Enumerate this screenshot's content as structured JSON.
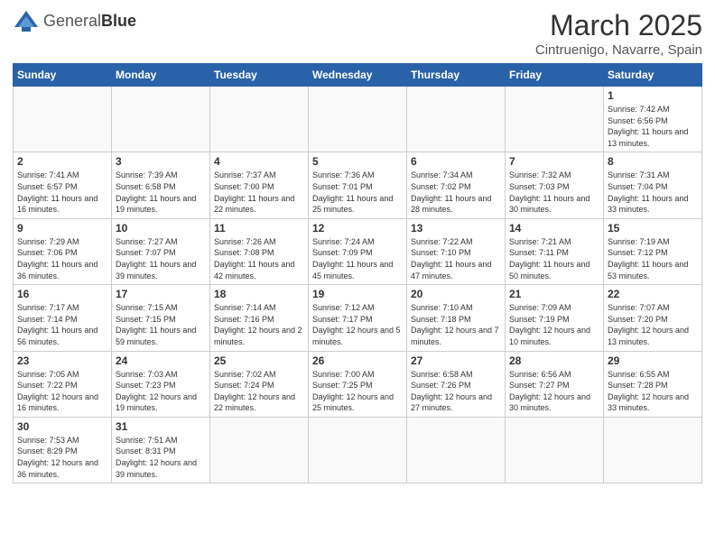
{
  "logo": {
    "text_normal": "General",
    "text_bold": "Blue"
  },
  "title": {
    "month_year": "March 2025",
    "location": "Cintruenigo, Navarre, Spain"
  },
  "days_of_week": [
    "Sunday",
    "Monday",
    "Tuesday",
    "Wednesday",
    "Thursday",
    "Friday",
    "Saturday"
  ],
  "weeks": [
    {
      "days": [
        {
          "num": "",
          "info": ""
        },
        {
          "num": "",
          "info": ""
        },
        {
          "num": "",
          "info": ""
        },
        {
          "num": "",
          "info": ""
        },
        {
          "num": "",
          "info": ""
        },
        {
          "num": "",
          "info": ""
        },
        {
          "num": "1",
          "info": "Sunrise: 7:42 AM\nSunset: 6:56 PM\nDaylight: 11 hours and 13 minutes."
        }
      ]
    },
    {
      "days": [
        {
          "num": "2",
          "info": "Sunrise: 7:41 AM\nSunset: 6:57 PM\nDaylight: 11 hours and 16 minutes."
        },
        {
          "num": "3",
          "info": "Sunrise: 7:39 AM\nSunset: 6:58 PM\nDaylight: 11 hours and 19 minutes."
        },
        {
          "num": "4",
          "info": "Sunrise: 7:37 AM\nSunset: 7:00 PM\nDaylight: 11 hours and 22 minutes."
        },
        {
          "num": "5",
          "info": "Sunrise: 7:36 AM\nSunset: 7:01 PM\nDaylight: 11 hours and 25 minutes."
        },
        {
          "num": "6",
          "info": "Sunrise: 7:34 AM\nSunset: 7:02 PM\nDaylight: 11 hours and 28 minutes."
        },
        {
          "num": "7",
          "info": "Sunrise: 7:32 AM\nSunset: 7:03 PM\nDaylight: 11 hours and 30 minutes."
        },
        {
          "num": "8",
          "info": "Sunrise: 7:31 AM\nSunset: 7:04 PM\nDaylight: 11 hours and 33 minutes."
        }
      ]
    },
    {
      "days": [
        {
          "num": "9",
          "info": "Sunrise: 7:29 AM\nSunset: 7:06 PM\nDaylight: 11 hours and 36 minutes."
        },
        {
          "num": "10",
          "info": "Sunrise: 7:27 AM\nSunset: 7:07 PM\nDaylight: 11 hours and 39 minutes."
        },
        {
          "num": "11",
          "info": "Sunrise: 7:26 AM\nSunset: 7:08 PM\nDaylight: 11 hours and 42 minutes."
        },
        {
          "num": "12",
          "info": "Sunrise: 7:24 AM\nSunset: 7:09 PM\nDaylight: 11 hours and 45 minutes."
        },
        {
          "num": "13",
          "info": "Sunrise: 7:22 AM\nSunset: 7:10 PM\nDaylight: 11 hours and 47 minutes."
        },
        {
          "num": "14",
          "info": "Sunrise: 7:21 AM\nSunset: 7:11 PM\nDaylight: 11 hours and 50 minutes."
        },
        {
          "num": "15",
          "info": "Sunrise: 7:19 AM\nSunset: 7:12 PM\nDaylight: 11 hours and 53 minutes."
        }
      ]
    },
    {
      "days": [
        {
          "num": "16",
          "info": "Sunrise: 7:17 AM\nSunset: 7:14 PM\nDaylight: 11 hours and 56 minutes."
        },
        {
          "num": "17",
          "info": "Sunrise: 7:15 AM\nSunset: 7:15 PM\nDaylight: 11 hours and 59 minutes."
        },
        {
          "num": "18",
          "info": "Sunrise: 7:14 AM\nSunset: 7:16 PM\nDaylight: 12 hours and 2 minutes."
        },
        {
          "num": "19",
          "info": "Sunrise: 7:12 AM\nSunset: 7:17 PM\nDaylight: 12 hours and 5 minutes."
        },
        {
          "num": "20",
          "info": "Sunrise: 7:10 AM\nSunset: 7:18 PM\nDaylight: 12 hours and 7 minutes."
        },
        {
          "num": "21",
          "info": "Sunrise: 7:09 AM\nSunset: 7:19 PM\nDaylight: 12 hours and 10 minutes."
        },
        {
          "num": "22",
          "info": "Sunrise: 7:07 AM\nSunset: 7:20 PM\nDaylight: 12 hours and 13 minutes."
        }
      ]
    },
    {
      "days": [
        {
          "num": "23",
          "info": "Sunrise: 7:05 AM\nSunset: 7:22 PM\nDaylight: 12 hours and 16 minutes."
        },
        {
          "num": "24",
          "info": "Sunrise: 7:03 AM\nSunset: 7:23 PM\nDaylight: 12 hours and 19 minutes."
        },
        {
          "num": "25",
          "info": "Sunrise: 7:02 AM\nSunset: 7:24 PM\nDaylight: 12 hours and 22 minutes."
        },
        {
          "num": "26",
          "info": "Sunrise: 7:00 AM\nSunset: 7:25 PM\nDaylight: 12 hours and 25 minutes."
        },
        {
          "num": "27",
          "info": "Sunrise: 6:58 AM\nSunset: 7:26 PM\nDaylight: 12 hours and 27 minutes."
        },
        {
          "num": "28",
          "info": "Sunrise: 6:56 AM\nSunset: 7:27 PM\nDaylight: 12 hours and 30 minutes."
        },
        {
          "num": "29",
          "info": "Sunrise: 6:55 AM\nSunset: 7:28 PM\nDaylight: 12 hours and 33 minutes."
        }
      ]
    },
    {
      "days": [
        {
          "num": "30",
          "info": "Sunrise: 7:53 AM\nSunset: 8:29 PM\nDaylight: 12 hours and 36 minutes."
        },
        {
          "num": "31",
          "info": "Sunrise: 7:51 AM\nSunset: 8:31 PM\nDaylight: 12 hours and 39 minutes."
        },
        {
          "num": "",
          "info": ""
        },
        {
          "num": "",
          "info": ""
        },
        {
          "num": "",
          "info": ""
        },
        {
          "num": "",
          "info": ""
        },
        {
          "num": "",
          "info": ""
        }
      ]
    }
  ]
}
